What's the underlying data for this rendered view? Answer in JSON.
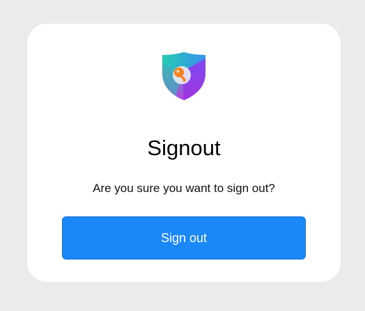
{
  "dialog": {
    "title": "Signout",
    "message": "Are you sure you want to sign out?",
    "signout_button_label": "Sign out"
  },
  "logo": {
    "icon": "shield-key-icon",
    "colors": {
      "teal": "#26c9b4",
      "blue": "#3a8ef0",
      "purple": "#9b3ce6",
      "magenta": "#c43ad6",
      "key": "#f5811f"
    }
  },
  "colors": {
    "background": "#ebebeb",
    "card": "#ffffff",
    "button": "#1a88f8",
    "button_text": "#ffffff"
  }
}
